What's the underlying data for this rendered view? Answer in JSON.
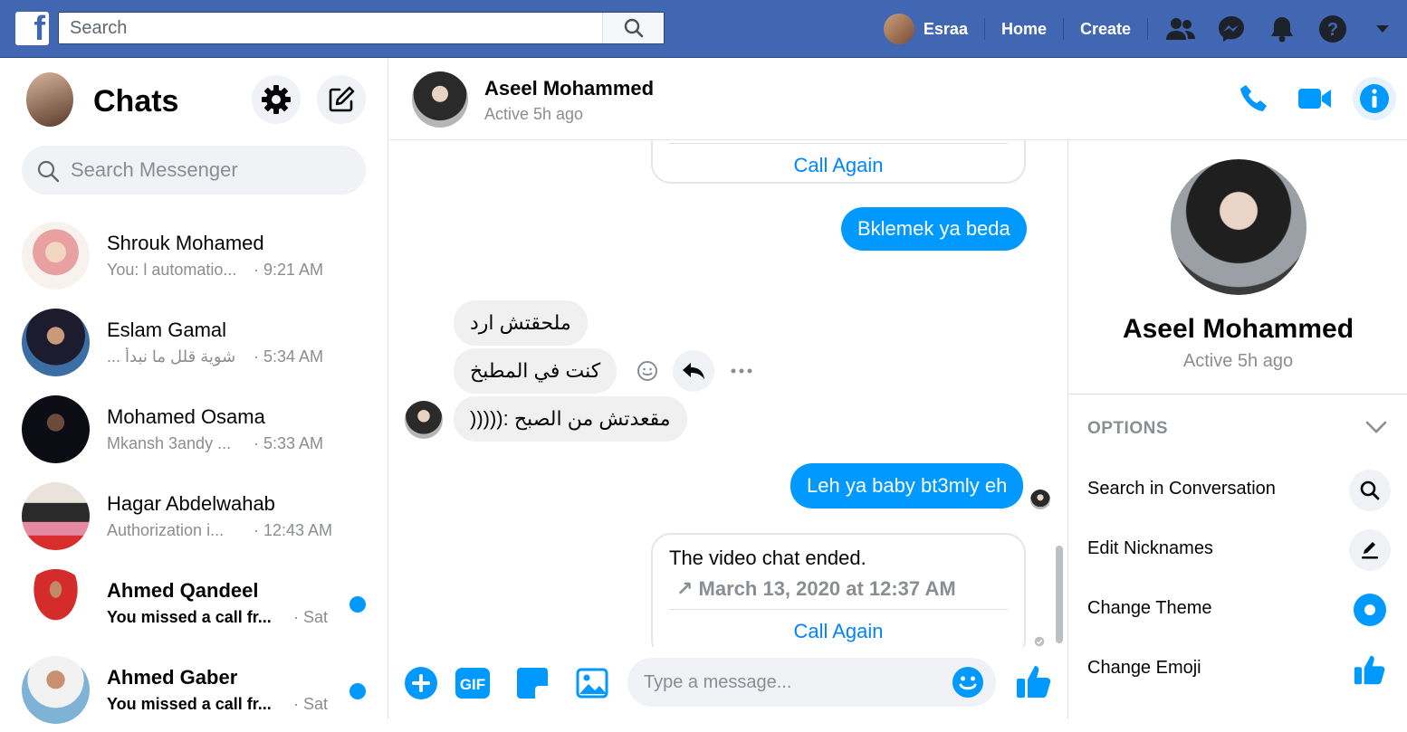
{
  "topbar": {
    "logo": "f",
    "search_placeholder": "Search",
    "user_name": "Esraa",
    "home": "Home",
    "create": "Create"
  },
  "sidebar": {
    "title": "Chats",
    "search_placeholder": "Search Messenger",
    "conversations": [
      {
        "name": "Shrouk Mohamed",
        "snippet": "You: l automatio...",
        "time": "· 9:21 AM",
        "unread": false
      },
      {
        "name": "Eslam Gamal",
        "snippet": "شوية قلل ما نبدأ ...",
        "time": "· 5:34 AM",
        "unread": false
      },
      {
        "name": "Mohamed Osama",
        "snippet": "Mkansh 3andy ...",
        "time": "· 5:33 AM",
        "unread": false
      },
      {
        "name": "Hagar Abdelwahab",
        "snippet": "Authorization i...",
        "time": "· 12:43 AM",
        "unread": false
      },
      {
        "name": "Ahmed Qandeel",
        "snippet": "You missed a call fr...",
        "time": "· Sat",
        "unread": true
      },
      {
        "name": "Ahmed Gaber",
        "snippet": "You missed a call fr...",
        "time": "· Sat",
        "unread": true
      }
    ]
  },
  "chat": {
    "contact_name": "Aseel Mohammed",
    "contact_status": "Active 5h ago",
    "messages": {
      "card1_call_again": "Call Again",
      "out1": "Bklemek ya beda",
      "in1": "ملحقتش ارد",
      "in2": "كنت في المطبخ",
      "in3": "مقعدتش من الصبح :(((((",
      "out2": "Leh ya baby bt3mly eh",
      "card2_title": "The video chat ended.",
      "card2_time": "↗ March 13, 2020 at 12:37 AM",
      "card2_call_again": "Call Again"
    },
    "composer_placeholder": "Type a message..."
  },
  "info_panel": {
    "name": "Aseel Mohammed",
    "status": "Active 5h ago",
    "options_title": "OPTIONS",
    "options": [
      {
        "label": "Search in Conversation",
        "icon": "search-icon"
      },
      {
        "label": "Edit Nicknames",
        "icon": "pencil-icon"
      },
      {
        "label": "Change Theme",
        "icon": "theme-icon"
      },
      {
        "label": "Change Emoji",
        "icon": "thumbs-up-icon"
      }
    ]
  },
  "colors": {
    "fb_blue": "#4267b2",
    "messenger_blue": "#0099ff",
    "bubble_gray": "#f0f0f0"
  }
}
